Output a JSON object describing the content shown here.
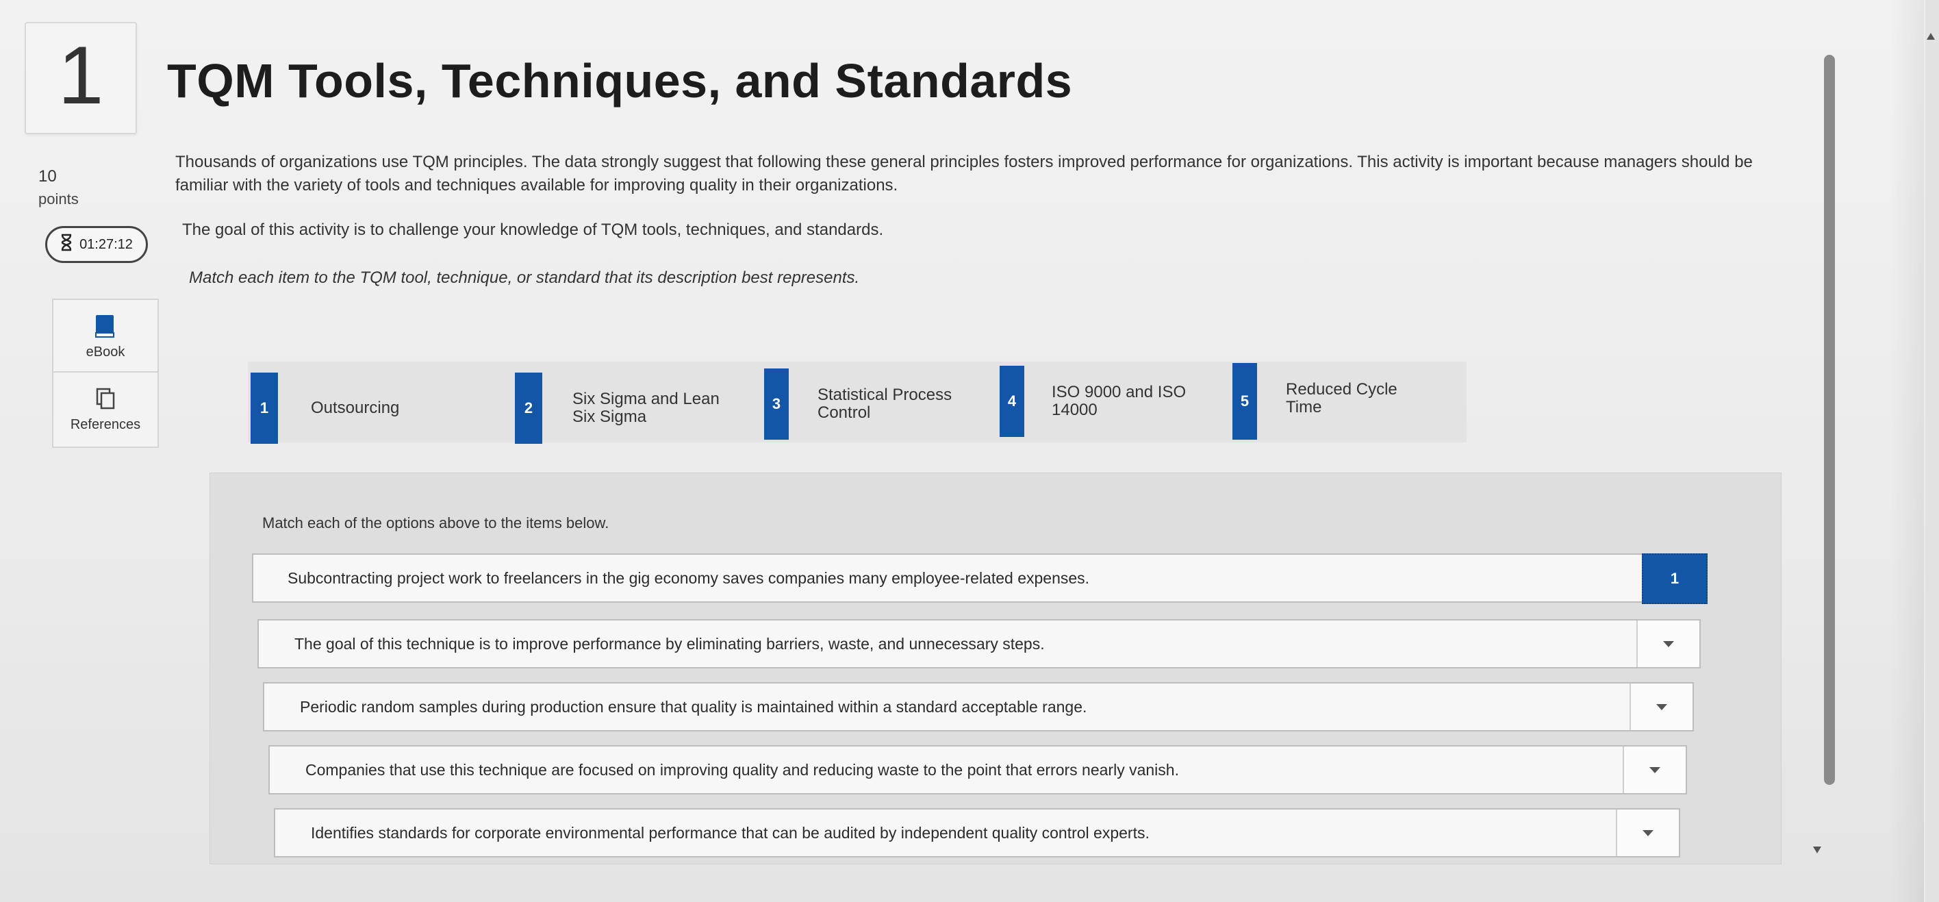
{
  "question": {
    "number": "1",
    "title": "TQM Tools, Techniques, and Standards",
    "points_value": "10",
    "points_label": "points",
    "timer": "01:27:12"
  },
  "sidebar": {
    "items": [
      {
        "label": "eBook",
        "icon": "book-icon"
      },
      {
        "label": "References",
        "icon": "documents-icon"
      }
    ]
  },
  "body": {
    "intro": "Thousands of organizations use TQM principles. The data strongly suggest that following these general principles fosters improved performance for organizations. This activity is important because managers should be familiar with the variety of tools and techniques available for improving quality in their organizations.",
    "goal": "The goal of this activity is to challenge your knowledge of TQM tools, techniques, and standards.",
    "instruction": "Match each item to the TQM tool, technique, or standard that its description best represents."
  },
  "options": [
    {
      "num": "1",
      "label": "Outsourcing"
    },
    {
      "num": "2",
      "label": "Six Sigma and Lean Six Sigma"
    },
    {
      "num": "3",
      "label": "Statistical Process Control"
    },
    {
      "num": "4",
      "label": "ISO 9000 and ISO 14000"
    },
    {
      "num": "5",
      "label": "Reduced Cycle Time"
    }
  ],
  "match": {
    "heading": "Match each of the options above to the items below.",
    "items": [
      {
        "text": "Subcontracting project work to freelancers in the gig economy saves companies many employee-related expenses.",
        "selected": "1"
      },
      {
        "text": "The goal of this technique is to improve performance by eliminating barriers, waste, and unnecessary steps.",
        "selected": ""
      },
      {
        "text": "Periodic random samples during production ensure that quality is maintained within a standard acceptable range.",
        "selected": ""
      },
      {
        "text": "Companies that use this technique are focused on improving quality and reducing waste to the point that errors nearly vanish.",
        "selected": ""
      },
      {
        "text": "Identifies standards for corporate environmental performance that can be audited by independent quality control experts.",
        "selected": ""
      }
    ]
  },
  "colors": {
    "accent": "#1355a6"
  }
}
